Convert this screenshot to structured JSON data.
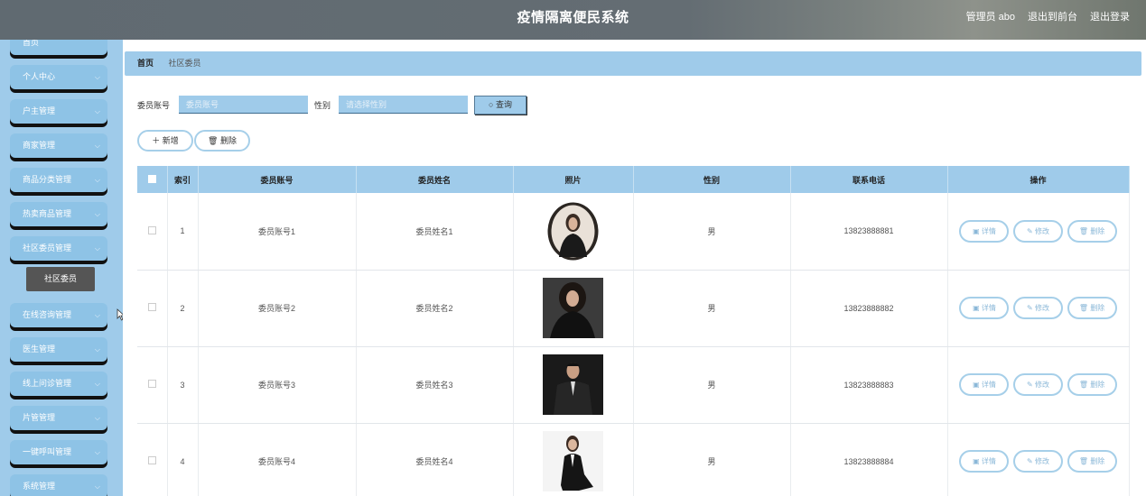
{
  "header": {
    "title": "疫情隔离便民系统",
    "user": "管理员 abo",
    "to_front": "退出到前台",
    "logout": "退出登录"
  },
  "sidebar": {
    "items": [
      {
        "label": "首页"
      },
      {
        "label": "个人中心"
      },
      {
        "label": "户主管理"
      },
      {
        "label": "商家管理"
      },
      {
        "label": "商品分类管理"
      },
      {
        "label": "热卖商品管理"
      },
      {
        "label": "社区委员管理"
      },
      {
        "label": "在线咨询管理"
      },
      {
        "label": "医生管理"
      },
      {
        "label": "线上问诊管理"
      },
      {
        "label": "片管管理"
      },
      {
        "label": "一键呼叫管理"
      },
      {
        "label": "系统管理"
      }
    ],
    "sub_item": "社区委员"
  },
  "breadcrumb": {
    "home": "首页",
    "current": "社区委员"
  },
  "search": {
    "account_label": "委员账号",
    "account_placeholder": "委员账号",
    "gender_label": "性别",
    "gender_placeholder": "请选择性别",
    "query_label": "查询"
  },
  "actions": {
    "add": "新增",
    "delete": "删除"
  },
  "table": {
    "headers": [
      "索引",
      "委员账号",
      "委员姓名",
      "照片",
      "性别",
      "联系电话",
      "操作"
    ],
    "rows": [
      {
        "index": "1",
        "account": "委员账号1",
        "name": "委员姓名1",
        "gender": "男",
        "phone": "13823888881"
      },
      {
        "index": "2",
        "account": "委员账号2",
        "name": "委员姓名2",
        "gender": "男",
        "phone": "13823888882"
      },
      {
        "index": "3",
        "account": "委员账号3",
        "name": "委员姓名3",
        "gender": "男",
        "phone": "13823888883"
      },
      {
        "index": "4",
        "account": "委员账号4",
        "name": "委员姓名4",
        "gender": "男",
        "phone": "13823888884"
      }
    ],
    "row_actions": {
      "detail": "详情",
      "edit": "修改",
      "delete": "删除"
    }
  },
  "colors": {
    "accent": "#9fcbea",
    "header": "#646d73",
    "dark": "#555555"
  }
}
